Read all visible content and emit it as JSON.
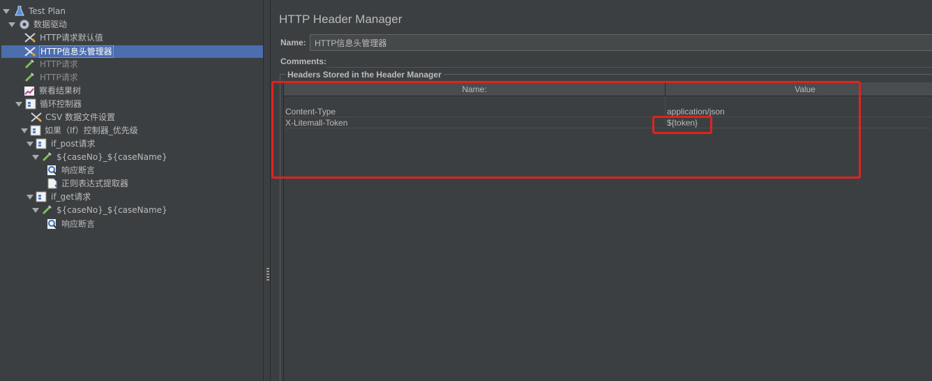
{
  "tree": {
    "nodes": [
      {
        "label": "Test Plan",
        "icon": "flask-icon"
      },
      {
        "label": "数据驱动",
        "icon": "gear-icon"
      },
      {
        "label": "HTTP请求默认值",
        "icon": "wrench-icon"
      },
      {
        "label": "HTTP信息头管理器",
        "icon": "wrench-icon"
      },
      {
        "label": "HTTP请求",
        "icon": "pipette-icon"
      },
      {
        "label": "HTTP请求",
        "icon": "pipette-icon"
      },
      {
        "label": "察看结果树",
        "icon": "chart-icon"
      },
      {
        "label": "循环控制器",
        "icon": "controller-icon"
      },
      {
        "label": "CSV 数据文件设置",
        "icon": "wrench-icon"
      },
      {
        "label": "如果（If）控制器_优先级",
        "icon": "controller-icon"
      },
      {
        "label": "if_post请求",
        "icon": "controller-icon"
      },
      {
        "label": "${caseNo}_${caseName}",
        "icon": "pipette-icon"
      },
      {
        "label": "响应断言",
        "icon": "magnifier-icon"
      },
      {
        "label": "正则表达式提取器",
        "icon": "document-icon"
      },
      {
        "label": "if_get请求",
        "icon": "controller-icon"
      },
      {
        "label": "${caseNo}_${caseName}",
        "icon": "pipette-icon"
      },
      {
        "label": "响应断言",
        "icon": "magnifier-icon"
      }
    ]
  },
  "panel": {
    "title": "HTTP Header Manager",
    "name_label": "Name:",
    "name_value": "HTTP信息头管理器",
    "comments_label": "Comments:",
    "section_title": "Headers Stored in the Header Manager"
  },
  "table": {
    "columns": [
      "Name:",
      "Value"
    ],
    "rows": [
      {
        "name": "Content-Type",
        "value": "application/json"
      },
      {
        "name": "X-Litemall-Token",
        "value": "${token}"
      }
    ]
  },
  "colors": {
    "background": "#3c3f41",
    "selection": "#4b6eaf",
    "annotation": "#e0231f"
  }
}
